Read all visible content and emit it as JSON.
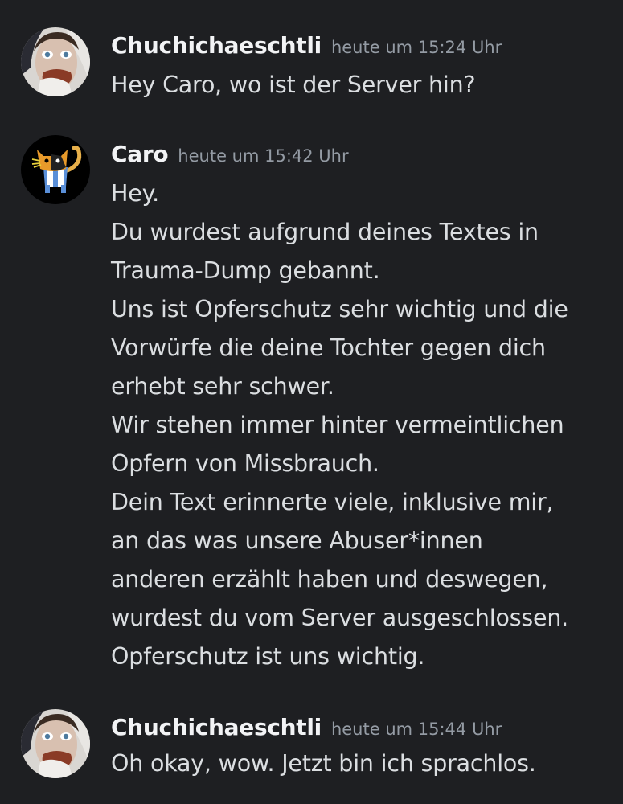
{
  "messages": [
    {
      "author": "Chuchichaeschtli",
      "timestamp": "heute um 15:24 Uhr",
      "avatar_icon": "person-photo-avatar",
      "lines": [
        "Hey Caro, wo ist der Server hin?"
      ]
    },
    {
      "author": "Caro",
      "timestamp": "heute um 15:42 Uhr",
      "avatar_icon": "cat-avatar",
      "lines": [
        "Hey.",
        "Du wurdest aufgrund deines Textes in",
        "Trauma-Dump gebannt.",
        "Uns ist Opferschutz sehr wichtig und die",
        "Vorwürfe die deine Tochter gegen dich",
        "erhebt sehr schwer.",
        "Wir stehen immer hinter vermeintlichen",
        "Opfern von Missbrauch.",
        "Dein Text erinnerte viele, inklusive mir,",
        "an das was unsere Abuser*innen",
        "anderen erzählt haben und deswegen,",
        "wurdest du vom Server ausgeschlossen.",
        "Opferschutz ist uns wichtig."
      ]
    },
    {
      "author": "Chuchichaeschtli",
      "timestamp": "heute um 15:44 Uhr",
      "avatar_icon": "person-photo-avatar",
      "lines": [
        "Oh okay, wow. Jetzt bin ich sprachlos."
      ]
    }
  ],
  "colors": {
    "background": "#1e1f22",
    "username": "#f2f3f5",
    "timestamp": "#949ba4",
    "text": "#dbdee1"
  }
}
